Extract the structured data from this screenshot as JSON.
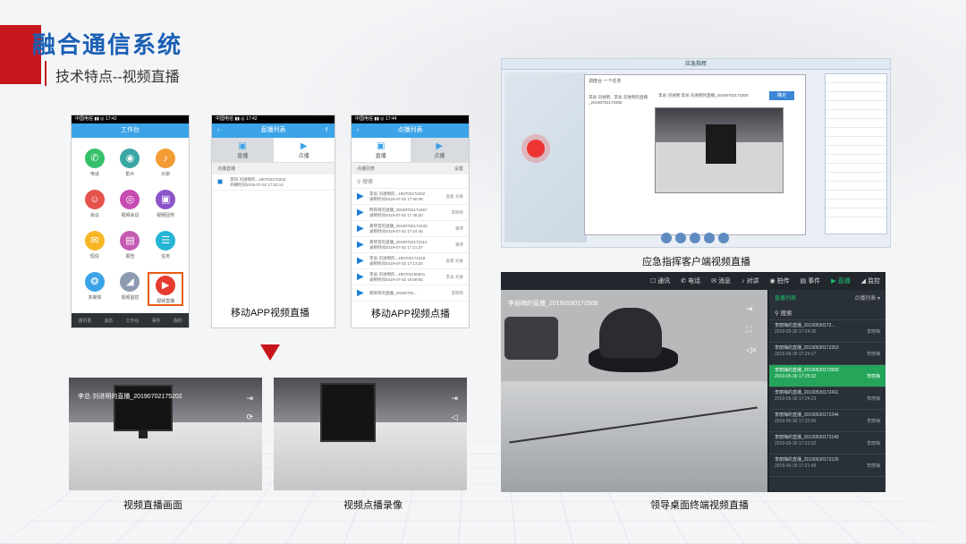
{
  "header": {
    "title": "融合通信系统",
    "subtitle": "技术特点--视频直播"
  },
  "phone_workbench": {
    "status": "中国电信 ▮▮ ◎ 17:42",
    "title": "工作台",
    "apps": [
      {
        "label": "电话",
        "icon": "phone-icon",
        "glyph": "✆",
        "color": "#36c06a"
      },
      {
        "label": "影片",
        "icon": "camera-icon",
        "glyph": "◉",
        "color": "#3aa7a4"
      },
      {
        "label": "对讲",
        "icon": "mic-icon",
        "glyph": "♪",
        "color": "#f39c34"
      },
      {
        "label": "会议",
        "icon": "people-icon",
        "glyph": "☺",
        "color": "#e5534b"
      },
      {
        "label": "视频会议",
        "icon": "webcam-icon",
        "glyph": "◎",
        "color": "#c74bb3"
      },
      {
        "label": "视频回传",
        "icon": "video-icon",
        "glyph": "▣",
        "color": "#8b55c9"
      },
      {
        "label": "短信",
        "icon": "message-icon",
        "glyph": "✉",
        "color": "#f6b727"
      },
      {
        "label": "报告",
        "icon": "report-icon",
        "glyph": "▤",
        "color": "#c45bb3"
      },
      {
        "label": "任务",
        "icon": "clipboard-icon",
        "glyph": "☰",
        "color": "#25b5d5"
      },
      {
        "label": "多媒体",
        "icon": "media-icon",
        "glyph": "❂",
        "color": "#3ba3e8"
      },
      {
        "label": "视频监控",
        "icon": "cctv-icon",
        "glyph": "◢",
        "color": "#8d9bb2"
      },
      {
        "label": "视频直播",
        "icon": "live-icon",
        "glyph": "▶",
        "color": "#e63b2e"
      }
    ],
    "nav": [
      "通讯录",
      "消息",
      "工作台",
      "事件",
      "我的"
    ]
  },
  "phone_live_list": {
    "status": "中国电信 ▮▮ ◎ 17:42",
    "title": "直播列表",
    "back": "‹",
    "share": "⇪",
    "tabs": [
      "直播",
      "点播"
    ],
    "list_header": "点播直播",
    "item_title": "李四·刘进明的...190702175202",
    "item_time": "开播时间2019-07-02 17:52:14"
  },
  "phone_vod_list": {
    "status": "中国电信 ▮▮ ◎ 17:44",
    "title": "点播列表",
    "back": "‹",
    "tabs": [
      "直播",
      "点播"
    ],
    "list_header": "点播列表",
    "list_header_right": "设置",
    "search": "搜索",
    "items": [
      {
        "title": "李总·刘进明的...190702175202",
        "time": "录制时间2019-07-02 17:50:08",
        "right": "查看·刘进"
      },
      {
        "title": "明哥哥的直播_20190702174457",
        "time": "录制时间2019-07-02 17:46:20",
        "right": "李明哥"
      },
      {
        "title": "黄琴音的直播_20190702172433",
        "time": "录制时间2019-07-02 17:24:46",
        "right": "黄琴"
      },
      {
        "title": "黄琴音的直播_20190702172113",
        "time": "录制时间2019-07-02 17:21:37",
        "right": "黄琴"
      },
      {
        "title": "李总·刘进明的...190702171319",
        "time": "录制时间2019-07-02 17:13:34",
        "right": "查看·刘进"
      },
      {
        "title": "李总·刘进明的...190702165941",
        "time": "录制时间2019-07-02 16:59:55",
        "right": "李总·刘进"
      },
      {
        "title": "明哥哥的直播_20190702...",
        "time": "",
        "right": "李明哥"
      }
    ]
  },
  "captions": {
    "mobile_live": "移动APP视频直播",
    "mobile_vod": "移动APP视频点播",
    "live_frame": "视频直播画面",
    "vod_recording": "视频点播录像",
    "dispatch_client": "应急指挥客户端视频直播",
    "desktop_terminal": "领导桌面终端视频直播"
  },
  "live_frame": {
    "overlay": "李总·刘进明的直播_20190702175202"
  },
  "dispatch": {
    "title": "应急指挥",
    "window_header": "调度台·一个任务",
    "left_text": "李总·刘进明、李总·刘进明的直播_20190702173300",
    "video_title": "李总·刘进明·李总·刘进明的直播_20190702173300",
    "confirm_label": "确定"
  },
  "terminal": {
    "nav": [
      {
        "label": "通讯",
        "icon": "contacts-icon",
        "glyph": "☐"
      },
      {
        "label": "电话",
        "icon": "phone-icon",
        "glyph": "✆"
      },
      {
        "label": "消息",
        "icon": "message-icon",
        "glyph": "✉"
      },
      {
        "label": "对讲",
        "icon": "mic-icon",
        "glyph": "♪"
      },
      {
        "label": "拍传",
        "icon": "camera-icon",
        "glyph": "◉"
      },
      {
        "label": "事件",
        "icon": "event-icon",
        "glyph": "▤"
      },
      {
        "label": "直播",
        "icon": "live-icon",
        "glyph": "▶"
      },
      {
        "label": "监控",
        "icon": "cctv-icon",
        "glyph": "◢"
      }
    ],
    "video_title": "李丽梅的直播_20190530172509",
    "list_tab_left": "直播列表",
    "list_tab_right": "点播列表",
    "search": "搜索",
    "items": [
      {
        "title": "李丽梅的直播_20190530172...",
        "time": "2019-05-30 17:24:36",
        "who": "李丽梅",
        "active": false
      },
      {
        "title": "李丽梅的直播_20190530172353",
        "time": "2019-05-30 17:24:17",
        "who": "李丽梅",
        "active": false
      },
      {
        "title": "李丽梅的直播_20190530172509",
        "time": "2019-05-30 17:25:32",
        "who": "李丽梅",
        "active": true
      },
      {
        "title": "李丽梅的直播_20190530172411",
        "time": "2019-05-30 17:24:23",
        "who": "李丽梅",
        "active": false
      },
      {
        "title": "李丽梅的直播_20190530172244",
        "time": "2019-05-30 17:22:56",
        "who": "李丽梅",
        "active": false
      },
      {
        "title": "李丽梅的直播_20190530172149",
        "time": "2019-05-30 17:22:02",
        "who": "李丽梅",
        "active": false
      },
      {
        "title": "李丽梅的直播_20190530172126",
        "time": "2019-05-30 17:21:49",
        "who": "李丽梅",
        "active": false
      }
    ]
  }
}
